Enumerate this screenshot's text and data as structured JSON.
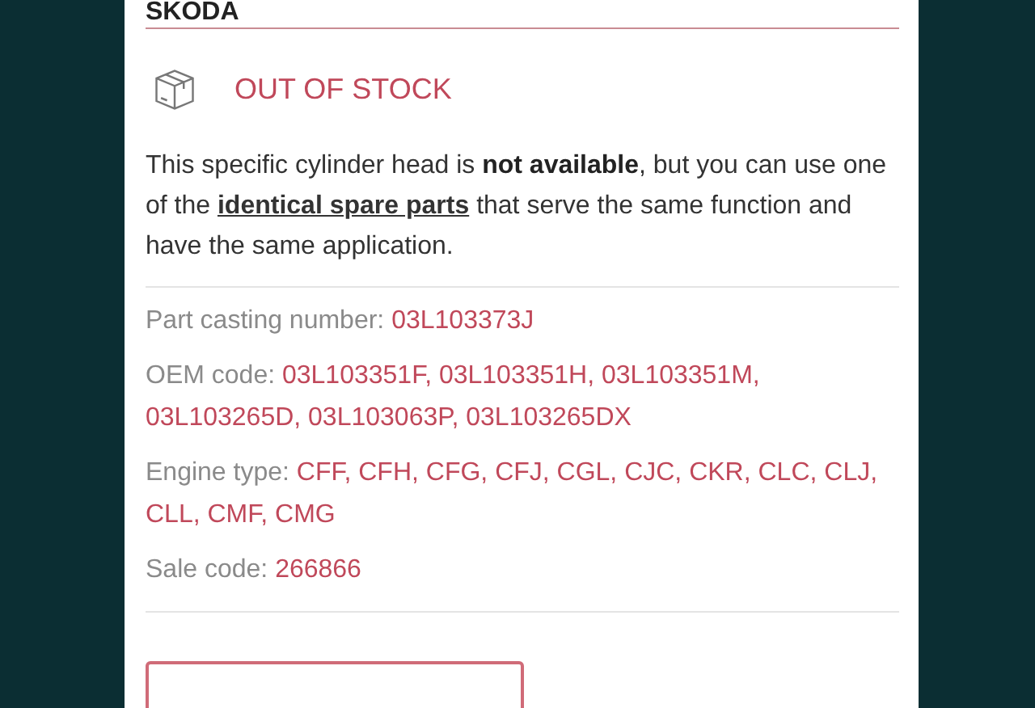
{
  "title": "SKODA",
  "stock_status": {
    "label": "OUT OF STOCK",
    "in_stock": false
  },
  "notice": {
    "text_before": "This specific cylinder head is **not available**, but you can use one of the",
    "link": "identical spare parts",
    "text_after": "that serve the same function and have the same application."
  },
  "details": [
    {
      "label": "Part casting number:",
      "value": "03L103373J"
    },
    {
      "label": "OEM code:",
      "value": "03L103351F, 03L103351H, 03L103351M, 03L103265D, 03L103063P, 03L103265DX"
    },
    {
      "label": "Engine type:",
      "value": "CFF, CFH, CFG, CFJ, CGL, CJC, CKR, CLC, CLJ, CLL, CMF, CMG"
    },
    {
      "label": "Sale code:",
      "value": "266866"
    }
  ],
  "action_button": {
    "kind": "outline"
  }
}
